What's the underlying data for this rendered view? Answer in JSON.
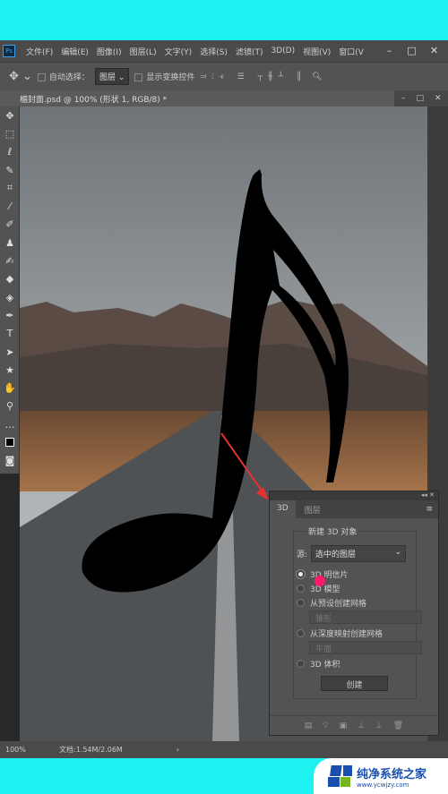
{
  "menu": {
    "logo": "Ps",
    "items": [
      "文件(F)",
      "编辑(E)",
      "图像(I)",
      "图层(L)",
      "文字(Y)",
      "选择(S)",
      "滤镜(T)",
      "3D(D)",
      "视图(V)",
      "窗口(V"
    ]
  },
  "options": {
    "auto_select": "自动选择：",
    "layer_select": "图层",
    "show_transform": "显示变换控件"
  },
  "document": {
    "tab_title": "楣封面.psd @ 100% (形状 1, RGB/8) *"
  },
  "panel": {
    "tabs": [
      "3D",
      "图层"
    ],
    "group_title": "新建 3D 对象",
    "source_label": "源:",
    "source_value": "选中的图层",
    "options": [
      {
        "label": "3D 明信片",
        "selected": true
      },
      {
        "label": "3D 模型",
        "selected": false
      },
      {
        "label": "从预设创建网格",
        "selected": false
      },
      {
        "label": "从深度映射创建网格",
        "selected": false
      },
      {
        "label": "3D 体积",
        "selected": false
      }
    ],
    "preset_value": "锥形",
    "depth_value": "平面",
    "create_button": "创建"
  },
  "status": {
    "zoom": "100%",
    "doc_size": "文档:1.54M/2.06M"
  },
  "watermark": {
    "brand": "纯净系统之家",
    "url": "www.ycwjzy.com"
  },
  "colors": {
    "background": "#1ef2f0",
    "ui_dark": "#535353",
    "cursor_highlight": "#ff1a6e",
    "arrow": "#e83030"
  }
}
